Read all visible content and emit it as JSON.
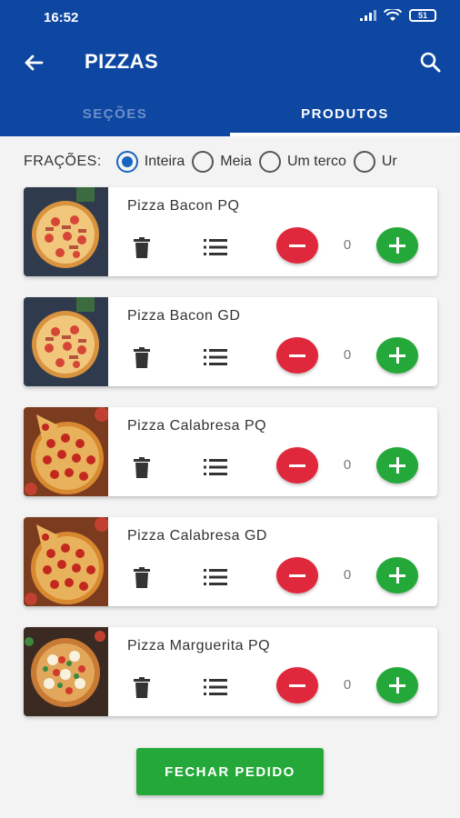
{
  "status_bar": {
    "time": "16:52",
    "battery": "51"
  },
  "toolbar": {
    "title": "PIZZAS",
    "back_icon": "arrow-left-icon",
    "search_icon": "search-icon"
  },
  "tabs": [
    {
      "label": "SEÇÕES",
      "active": false
    },
    {
      "label": "PRODUTOS",
      "active": true
    }
  ],
  "fractions": {
    "label": "FRAÇÕES:",
    "options": [
      {
        "label": "Inteira",
        "checked": true
      },
      {
        "label": "Meia",
        "checked": false
      },
      {
        "label": "Um terco",
        "checked": false
      },
      {
        "label": "Ur",
        "checked": false
      }
    ]
  },
  "products": [
    {
      "name": "Pizza Bacon PQ",
      "quantity": "0",
      "image": "pizza-bacon"
    },
    {
      "name": "Pizza Bacon GD",
      "quantity": "0",
      "image": "pizza-bacon"
    },
    {
      "name": "Pizza Calabresa PQ",
      "quantity": "0",
      "image": "pizza-calabresa"
    },
    {
      "name": "Pizza Calabresa GD",
      "quantity": "0",
      "image": "pizza-calabresa"
    },
    {
      "name": "Pizza Marguerita PQ",
      "quantity": "0",
      "image": "pizza-marguerita"
    }
  ],
  "footer": {
    "checkout_label": "FECHAR PEDIDO"
  },
  "colors": {
    "primary": "#0d47a1",
    "accent_green": "#25a83a",
    "accent_red": "#e0283c"
  }
}
